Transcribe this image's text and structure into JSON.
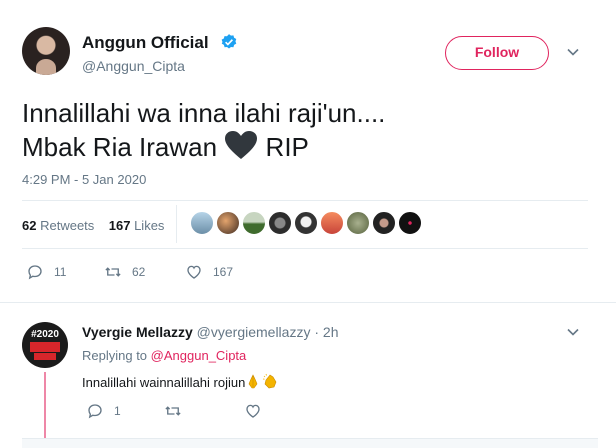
{
  "tweet": {
    "author": {
      "name": "Anggun Official",
      "handle": "@Anggun_Cipta",
      "verified": true
    },
    "follow_label": "Follow",
    "text_line1": "Innalillahi wa inna ilahi raji'un....",
    "text_line2_pre": "Mbak Ria Irawan",
    "text_line2_post": "RIP",
    "timestamp": "4:29 PM - 5 Jan 2020",
    "stats": {
      "retweets_count": "62",
      "retweets_label": "Retweets",
      "likes_count": "167",
      "likes_label": "Likes"
    },
    "actions": {
      "replies": "11",
      "retweets": "62",
      "likes": "167"
    },
    "accent_color": "#e0245e",
    "liker_count_shown": 9
  },
  "reply": {
    "author_name": "Vyergie Mellazzy",
    "author_handle": "@vyergiemellazzy",
    "age": "2h",
    "replying_label": "Replying to",
    "replying_handle": "@Anggun_Cipta",
    "text": "Innalillahi wainnalillahi rojiun",
    "avatar_text": "#2020",
    "actions": {
      "replies": "1"
    }
  },
  "icons": [
    "verified-badge-icon",
    "chevron-down-icon",
    "black-heart-emoji",
    "reply-icon",
    "retweet-icon",
    "like-icon",
    "folded-hands-emoji",
    "clapping-hands-emoji"
  ]
}
